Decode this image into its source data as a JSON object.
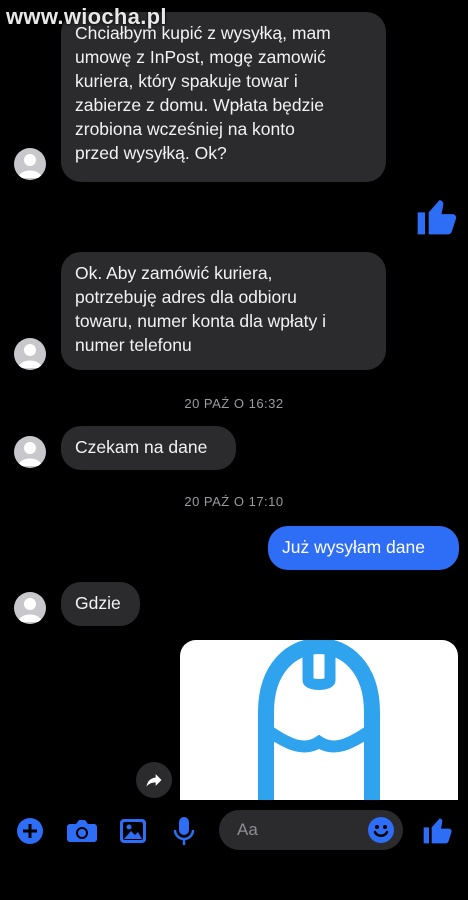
{
  "watermark": "www.wiocha.pl",
  "messages": [
    {
      "text": "Chciałbym kupić z wysyłką, mam\numowę z InPost, mogę zamowić\nkuriera, który spakuje towar i\nzabierze z domu. Wpłata będzie\nzrobiona wcześniej na konto\nprzed wysyłką. Ok?"
    },
    {
      "text": "Ok. Aby zamówić kuriera,\npotrzebuję adres dla odbioru\ntowaru,  numer konta dla wpłaty i\nnumer telefonu"
    },
    {
      "text": "Czekam na dane"
    },
    {
      "text": "Już wysyłam dane"
    },
    {
      "text": "Gdzie"
    }
  ],
  "timestamps": [
    "20 PAŹ O 16:32",
    "20 PAŹ O 17:10"
  ],
  "composer": {
    "placeholder": "Aa"
  },
  "colors": {
    "accent": "#2e6df5",
    "incoming_bubble": "#2b2b2d",
    "background": "#000000"
  },
  "icons": [
    "like-icon",
    "share-icon",
    "plus-icon",
    "camera-icon",
    "gallery-icon",
    "microphone-icon",
    "emoji-icon"
  ]
}
